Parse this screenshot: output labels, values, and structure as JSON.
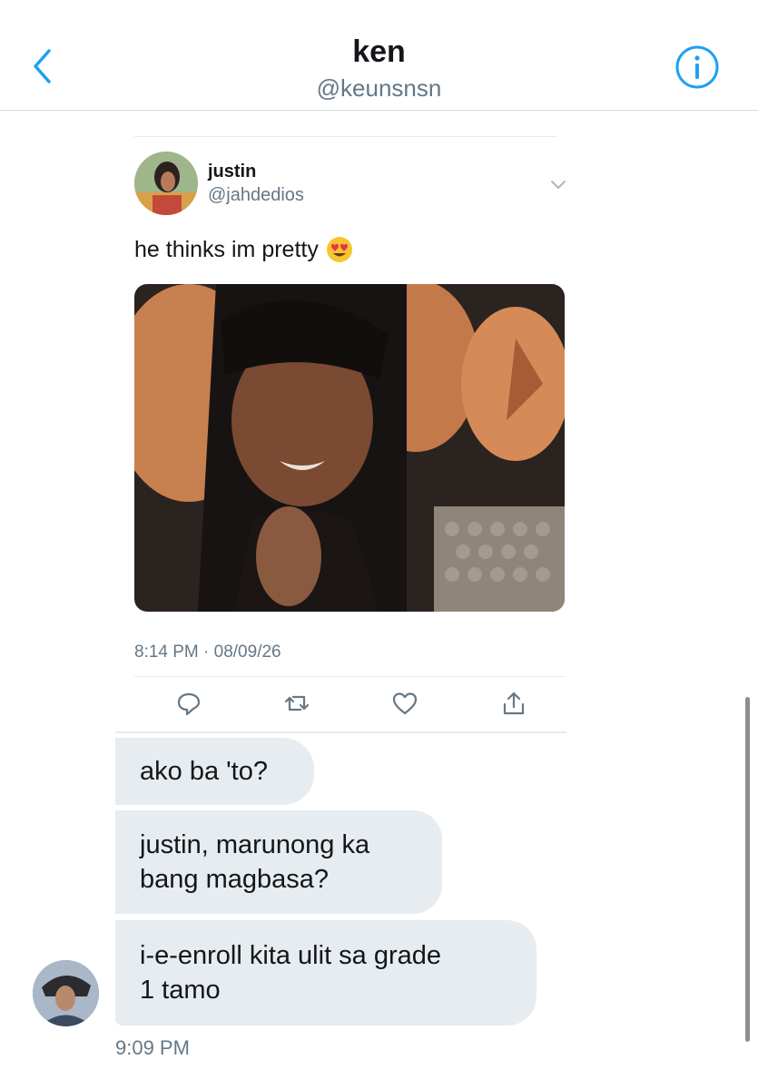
{
  "header": {
    "title": "ken",
    "subtitle": "@keunsnsn",
    "back_icon": "chevron-left-icon",
    "info_icon": "info-circle-icon",
    "accent_color": "#1DA1F2"
  },
  "shared_tweet": {
    "author_name": "justin",
    "author_handle": "@jahdedios",
    "text": "he thinks im pretty",
    "emoji": "heart-eyes-emoji",
    "timestamp": "8:14 PM · 08/09/26",
    "actions": [
      {
        "icon": "reply-icon"
      },
      {
        "icon": "retweet-icon"
      },
      {
        "icon": "like-icon"
      },
      {
        "icon": "share-icon"
      }
    ]
  },
  "messages": [
    {
      "lines": [
        "ako ba 'to?"
      ]
    },
    {
      "lines": [
        "justin, marunong ka",
        "bang magbasa?"
      ]
    },
    {
      "lines": [
        "i-e-enroll kita ulit sa grade",
        "1 tamo"
      ]
    }
  ],
  "message_time": "9:09 PM",
  "colors": {
    "bubble_bg": "#E6ECF0",
    "secondary_text": "#657786",
    "primary_text": "#14171A"
  }
}
